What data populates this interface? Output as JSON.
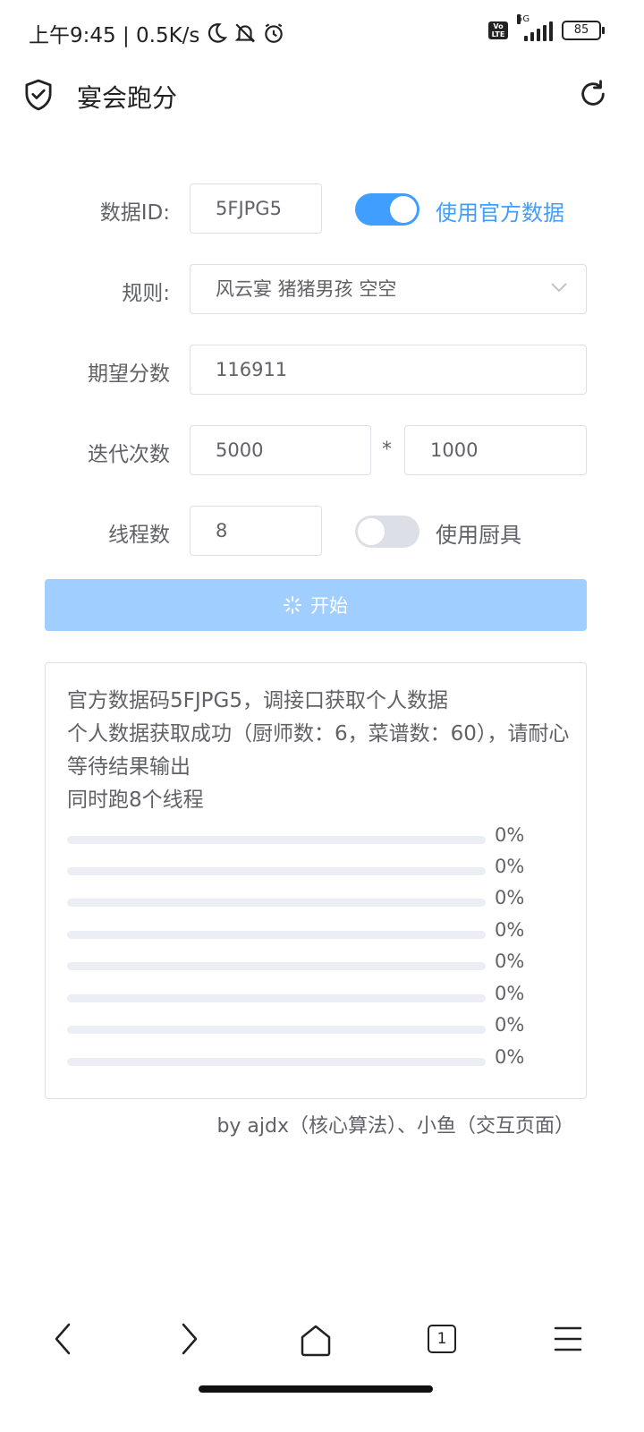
{
  "status_bar": {
    "time_speed": "上午9:45 | 0.5K/s",
    "volte": "Vo LTE",
    "network": "5G",
    "battery": "85"
  },
  "header": {
    "title": "宴会跑分"
  },
  "form": {
    "data_id_label": "数据ID:",
    "data_id_value": "5FJPG5",
    "official_switch_label": "使用官方数据",
    "official_switch_on": true,
    "rule_label": "规则:",
    "rule_value": "风云宴 猪猪男孩 空空",
    "expected_label": "期望分数",
    "expected_value": "116911",
    "iter_label": "迭代次数",
    "iter_value_1": "5000",
    "iter_times": "*",
    "iter_value_2": "1000",
    "threads_label": "线程数",
    "threads_value": "8",
    "tools_switch_label": "使用厨具",
    "tools_switch_on": false,
    "start_label": "开始"
  },
  "log": {
    "lines": [
      "官方数据码5FJPG5，调接口获取个人数据",
      "个人数据获取成功（厨师数：6，菜谱数：60），请耐心等待结果输出",
      "同时跑8个线程"
    ],
    "progress": [
      {
        "label": "0%",
        "value": 0
      },
      {
        "label": "0%",
        "value": 0
      },
      {
        "label": "0%",
        "value": 0
      },
      {
        "label": "0%",
        "value": 0
      },
      {
        "label": "0%",
        "value": 0
      },
      {
        "label": "0%",
        "value": 0
      },
      {
        "label": "0%",
        "value": 0
      },
      {
        "label": "0%",
        "value": 0
      }
    ]
  },
  "credit": "by ajdx（核心算法）、小鱼（交互页面）",
  "nav": {
    "tab_count": "1"
  },
  "colors": {
    "primary": "#409eff",
    "primary_disabled": "#a0cfff",
    "border": "#dcdfe6",
    "text": "#606266"
  }
}
